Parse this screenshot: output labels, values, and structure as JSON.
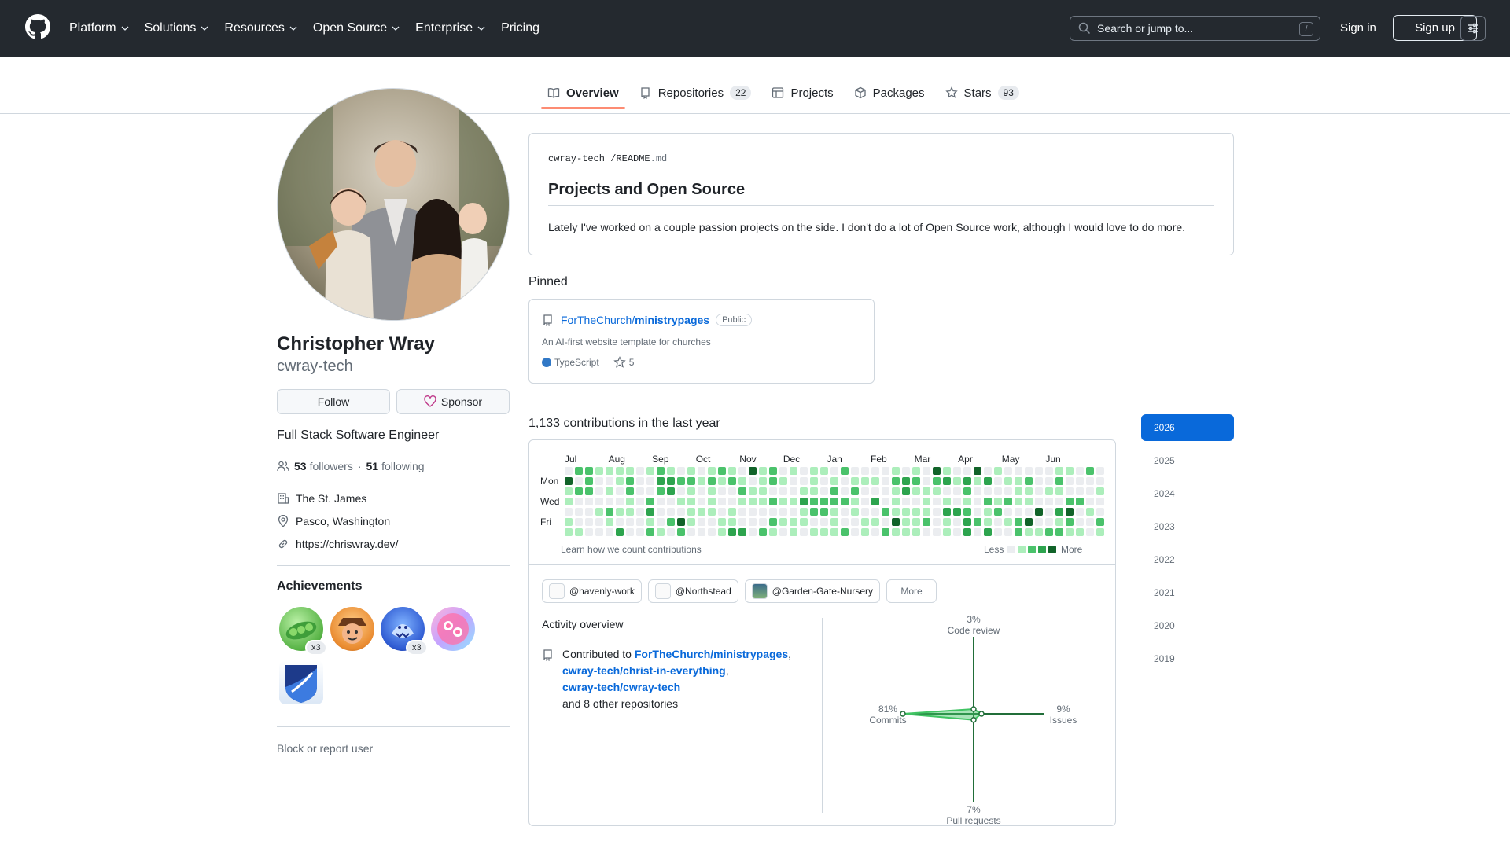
{
  "header": {
    "nav": [
      "Platform",
      "Solutions",
      "Resources",
      "Open Source",
      "Enterprise",
      "Pricing"
    ],
    "nav_dropdown": [
      true,
      true,
      true,
      true,
      true,
      false
    ],
    "search_placeholder": "Search or jump to...",
    "search_key": "/",
    "sign_in": "Sign in",
    "sign_up": "Sign up"
  },
  "tabs": [
    {
      "label": "Overview",
      "count": null,
      "icon": "book-icon",
      "active": true
    },
    {
      "label": "Repositories",
      "count": "22",
      "icon": "repo-icon",
      "active": false
    },
    {
      "label": "Projects",
      "count": null,
      "icon": "table-icon",
      "active": false
    },
    {
      "label": "Packages",
      "count": null,
      "icon": "package-icon",
      "active": false
    },
    {
      "label": "Stars",
      "count": "93",
      "icon": "star-icon",
      "active": false
    }
  ],
  "profile": {
    "name": "Christopher Wray",
    "login": "cwray-tech",
    "follow": "Follow",
    "sponsor": "Sponsor",
    "bio": "Full Stack Software Engineer",
    "followers_count": "53",
    "followers_label": "followers",
    "separator": "·",
    "following_count": "51",
    "following_label": "following",
    "company": "The St. James",
    "location": "Pasco, Washington",
    "website": "https://chriswray.dev/",
    "achievements_title": "Achievements",
    "badge_multipliers": [
      "x3",
      "x3"
    ],
    "block": "Block or report user"
  },
  "readme": {
    "owner": "cwray-tech",
    "sep": "/",
    "file": "README",
    "ext": ".md",
    "heading": "Projects and Open Source",
    "text": "Lately I've worked on a couple passion projects on the side. I don't do a lot of Open Source work, although I would love to do more."
  },
  "pinned": {
    "title": "Pinned",
    "owner": "ForTheChurch/",
    "repo": "ministrypages",
    "visibility": "Public",
    "description": "An AI-first website template for churches",
    "language": "TypeScript",
    "language_color": "#3178c6",
    "stars": "5"
  },
  "contributions": {
    "title": "1,133 contributions in the last year",
    "months": [
      "Jul",
      "Aug",
      "Sep",
      "Oct",
      "Nov",
      "Dec",
      "Jan",
      "Feb",
      "Mar",
      "Apr",
      "May",
      "Jun"
    ],
    "days": [
      "Mon",
      "Wed",
      "Fri"
    ],
    "learn": "Learn how we count contributions",
    "less": "Less",
    "more": "More",
    "colors": [
      "#ebedf0",
      "#aceebb",
      "#4ac26b",
      "#2da44e",
      "#116329"
    ]
  },
  "orgs": [
    {
      "label": "@havenly-work"
    },
    {
      "label": "@Northstead"
    },
    {
      "label": "@Garden-Gate-Nursery"
    }
  ],
  "orgs_more": "More",
  "activity": {
    "title": "Activity overview",
    "contributed_to": "Contributed to",
    "repos": [
      "ForTheChurch/ministrypages",
      "cwray-tech/christ-in-everything",
      "cwray-tech/cwray-tech"
    ],
    "others": "and 8 other repositories",
    "radar": {
      "code_review": {
        "pct": "3%",
        "label": "Code review",
        "value": 3
      },
      "issues": {
        "pct": "9%",
        "label": "Issues",
        "value": 9
      },
      "pull_requests": {
        "pct": "7%",
        "label": "Pull requests",
        "value": 7
      },
      "commits": {
        "pct": "81%",
        "label": "Commits",
        "value": 81
      }
    }
  },
  "years": [
    "2026",
    "2025",
    "2024",
    "2023",
    "2022",
    "2021",
    "2020",
    "2019"
  ],
  "active_year": "2026"
}
